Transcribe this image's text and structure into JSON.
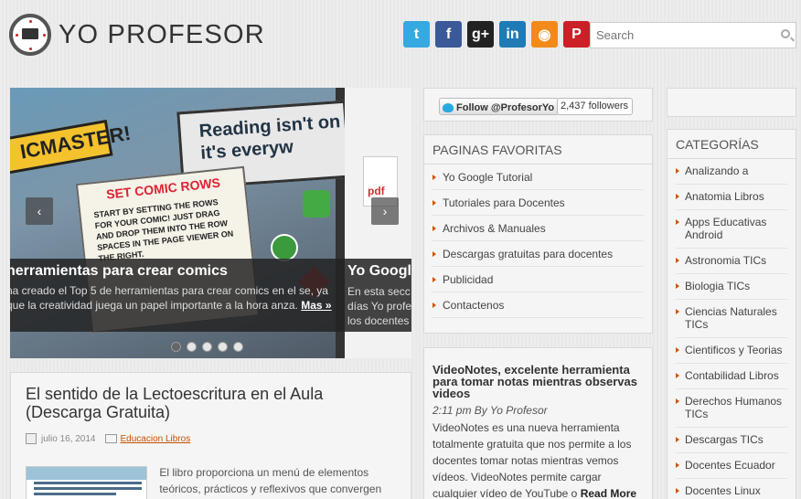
{
  "header": {
    "logo_text": "Yo Profesor",
    "search_placeholder": "Search",
    "social": [
      {
        "name": "twitter",
        "glyph": "t",
        "color": "#35a9e0"
      },
      {
        "name": "facebook",
        "glyph": "f",
        "color": "#3b5998"
      },
      {
        "name": "google-plus",
        "glyph": "g+",
        "color": "#222"
      },
      {
        "name": "linkedin",
        "glyph": "in",
        "color": "#1f7bb6"
      },
      {
        "name": "rss",
        "glyph": "◉",
        "color": "#f28a1b"
      },
      {
        "name": "pinterest",
        "glyph": "P",
        "color": "#cb2027"
      }
    ]
  },
  "slider": {
    "image_board_text": "Reading isn't on it's everyw",
    "image_page_title": "SET COMIC ROWS",
    "image_page_text": "START BY SETTING THE ROWS FOR YOUR COMIC! JUST DRAG AND DROP THEM INTO THE ROW SPACES IN THE PAGE VIEWER ON THE RIGHT.",
    "image_logo_text": "ICMASTER!",
    "slide1": {
      "title": "herramientas para crear comics",
      "text": "na creado el Top 5 de herramientas para crear comics en el se, ya que la creatividad juega un papel importante a la hora anza.",
      "more": "Mas »"
    },
    "slide2": {
      "title": "Yo Google",
      "line1": "En esta secc",
      "line2": "días Yo profe",
      "line3": "los docentes"
    },
    "pdf_label": "pdf",
    "prev_arrow": "‹",
    "next_arrow": "›",
    "dots_count": 5,
    "active_dot": 0
  },
  "follow": {
    "button_label": "Follow @ProfesorYo",
    "count_label": "2,437 followers"
  },
  "favorites": {
    "title": "PAGINAS FAVORITAS",
    "items": [
      "Yo Google Tutorial",
      "Tutoriales para Docentes",
      "Archivos & Manuales",
      "Descargas gratuitas para docentes",
      "Publicidad",
      "Contactenos"
    ]
  },
  "categories": {
    "title": "CATEGORÍAS",
    "items": [
      "Analizando a",
      "Anatomia Libros",
      "Apps Educativas Android",
      "Astronomia TICs",
      "Biologia TICs",
      "Ciencias Naturales TICs",
      "Cientificos y Teorias",
      "Contabilidad Libros",
      "Derechos Humanos TICs",
      "Descargas TICs",
      "Docentes Ecuador",
      "Docentes Linux"
    ]
  },
  "video_post": {
    "title": "VideoNotes, excelente herramienta para tomar notas mientras observas videos",
    "meta": "2:11 pm By Yo Profesor",
    "text": "VideoNotes es una nueva herramienta totalmente gratuita que nos permite a los docentes tomar notas mientras vemos vídeos. VideoNotes permite cargar cualquier vídeo de YouTube o",
    "more": "Read More"
  },
  "article": {
    "title": "El sentido de la Lectoescritura en el Aula (Descarga Gratuita)",
    "date": "julio 16, 2014",
    "category": "Educacion Libros",
    "excerpt": "El libro proporciona un menú de elementos teóricos, prácticos y reflexivos que convergen en"
  },
  "colors": {
    "accent": "#d35400",
    "background": "#ececec"
  }
}
